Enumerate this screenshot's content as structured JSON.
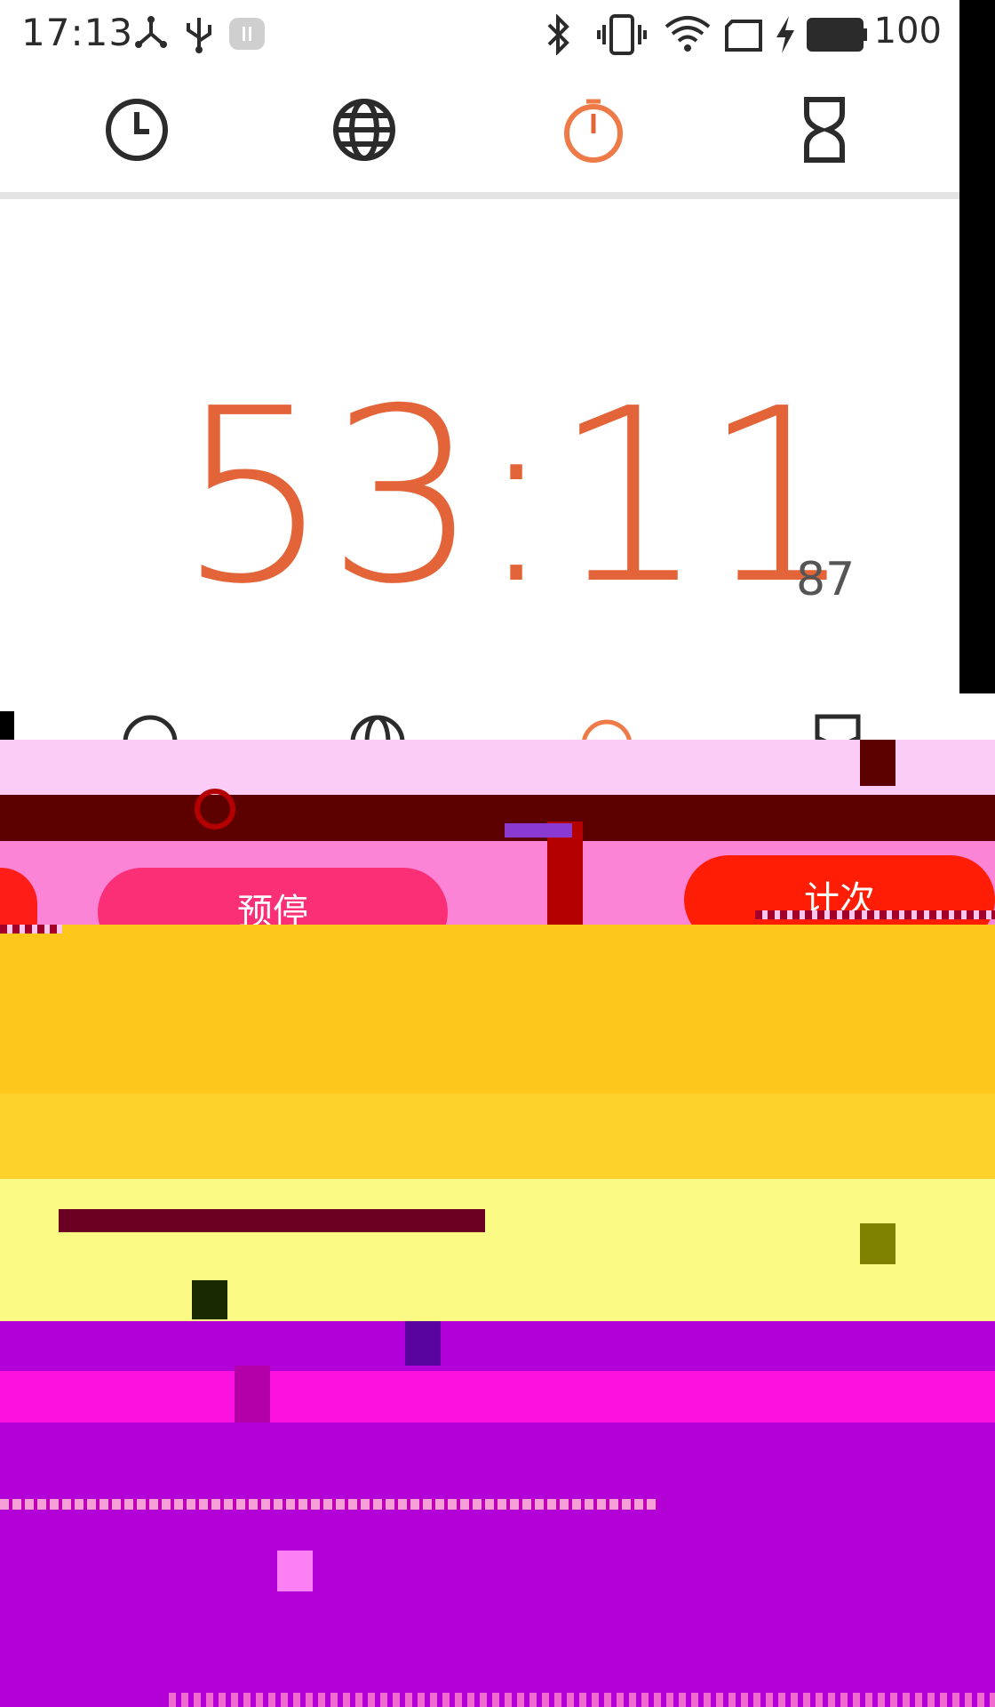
{
  "status_bar": {
    "time": "17:13",
    "left_icons": [
      "share-network-icon",
      "usb-icon",
      "app-notification-icon"
    ],
    "right_icons": [
      "bluetooth-icon",
      "vibrate-icon",
      "wifi-icon",
      "screen-icon",
      "charging-icon",
      "battery-icon"
    ],
    "battery_percent": "100"
  },
  "top_nav": {
    "tabs": [
      {
        "name": "alarm",
        "icon": "clock-icon",
        "active": false
      },
      {
        "name": "world-clock",
        "icon": "globe-icon",
        "active": false
      },
      {
        "name": "stopwatch",
        "icon": "stopwatch-icon",
        "active": true
      },
      {
        "name": "timer",
        "icon": "hourglass-icon",
        "active": false
      }
    ],
    "accent_color": "#e4643a"
  },
  "stopwatch": {
    "main": "53:11",
    "fraction": "87"
  },
  "lower_area": {
    "left_button_label": "预停",
    "right_button_label": "计次"
  }
}
